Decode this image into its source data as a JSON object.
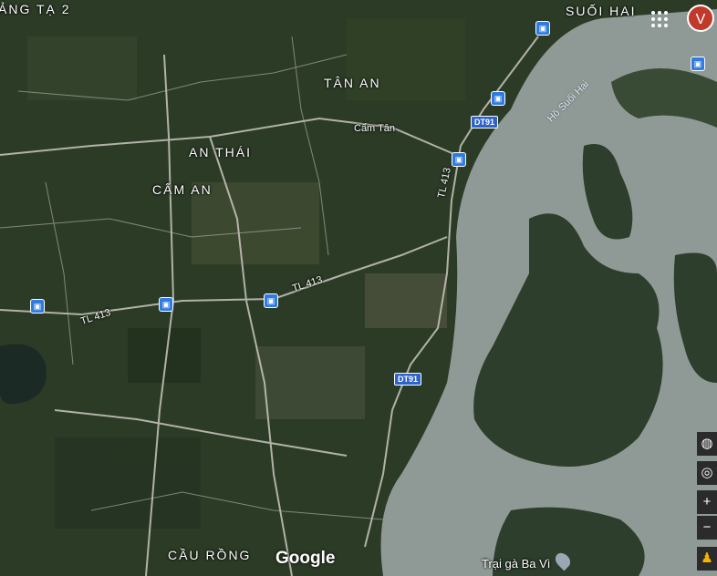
{
  "map": {
    "labels": {
      "top_left_cut": "ẢNG TẠ 2",
      "suoi_hai": "SUỐI HAI",
      "tan_an": "TÂN AN",
      "cam_tan": "Cẩm Tân",
      "an_thai": "AN THÁI",
      "cam_an": "CẨM AN",
      "cau_rong": "CẦU RỒNG",
      "lake": "Hồ Suối Hai",
      "trai_ga": "Trại gà Ba Vì"
    },
    "roads": {
      "tl413_a": "TL 413",
      "tl413_b": "TL 413",
      "tl413_c": "TL 413",
      "dt91_a": "DT91",
      "dt91_b": "DT91"
    },
    "branding": "Google",
    "account_initial": "V"
  },
  "colors": {
    "land": "#2c3b26",
    "water": "#8f9996",
    "road": "#c9c7bf",
    "shield": "#2f63c8",
    "avatar": "#c0392b"
  },
  "icons": {
    "apps": "apps-grid-icon",
    "globe": "globe-icon",
    "locate": "locate-icon",
    "zoom_in": "plus-icon",
    "zoom_out": "minus-icon",
    "pegman": "pegman-icon",
    "bus": "bus-stop-icon",
    "pin": "place-pin-icon"
  }
}
